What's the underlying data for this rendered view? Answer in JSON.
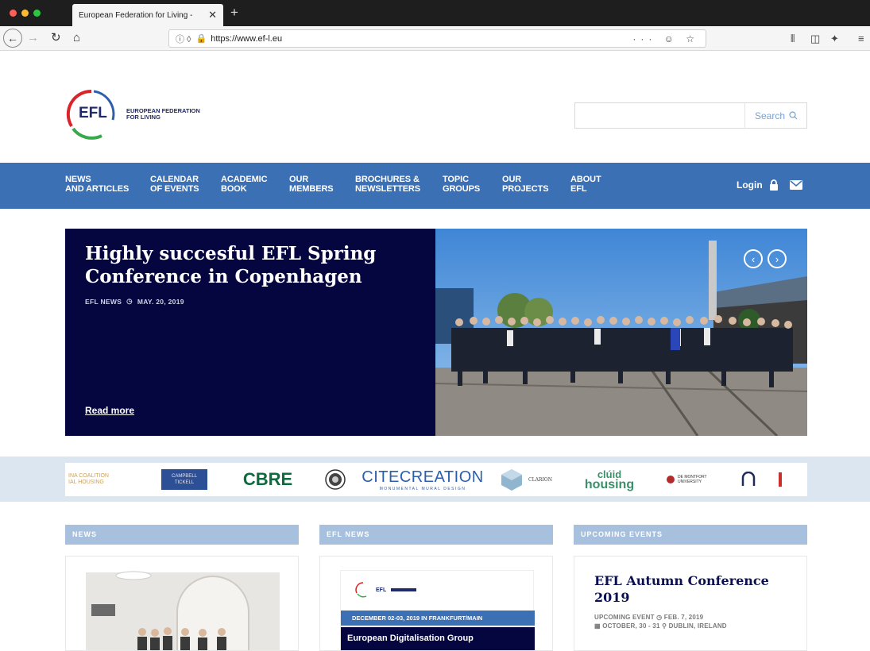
{
  "browser": {
    "tab_title": "European Federation for Living -",
    "tab_close": "✕",
    "new_tab": "+",
    "url": "https://www.ef-l.eu",
    "url_actions": "··· ☺ ☆",
    "overflow": "»"
  },
  "site": {
    "logo_abbr": "EFL",
    "logo_line1": "EUROPEAN FEDERATION",
    "logo_line2": "FOR LIVING"
  },
  "search": {
    "placeholder": "",
    "button_label": "Search"
  },
  "nav": {
    "items": [
      {
        "line1": "NEWS",
        "line2": "AND ARTICLES"
      },
      {
        "line1": "CALENDAR",
        "line2": "OF EVENTS"
      },
      {
        "line1": "ACADEMIC",
        "line2": "BOOK"
      },
      {
        "line1": "OUR",
        "line2": "MEMBERS"
      },
      {
        "line1": "BROCHURES &",
        "line2": "NEWSLETTERS"
      },
      {
        "line1": "TOPIC",
        "line2": "GROUPS"
      },
      {
        "line1": "OUR",
        "line2": "PROJECTS"
      },
      {
        "line1": "ABOUT",
        "line2": "EFL"
      }
    ],
    "login_label": "Login"
  },
  "hero": {
    "title": "Highly succesful EFL Spring Conference in Copenhagen",
    "category": "EFL NEWS",
    "date": "MAY. 20, 2019",
    "read_more": "Read more",
    "prev": "‹",
    "next": "›"
  },
  "members": {
    "logos": [
      {
        "line1": "INA COALITION",
        "line2": "IAL HOUSING"
      },
      {
        "line1": "CAMPBELL",
        "line2": "TICKELL"
      },
      {
        "text": "CBRE"
      },
      {
        "text": "CITECREATION",
        "sub": "MONUMENTAL MURAL DESIGN"
      },
      {
        "text": "CLARION"
      },
      {
        "line1": "clúid",
        "line2": "housing"
      },
      {
        "text": "DE MONTFORT UNIVERSITY"
      }
    ]
  },
  "columns": {
    "news_header": "NEWS",
    "efl_news_header": "EFL NEWS",
    "events_header": "UPCOMING EVENTS"
  },
  "efl_news_card": {
    "logo_abbr": "EFL",
    "banner": "DECEMBER 02-03, 2019 IN FRANKFURT/MAIN",
    "banner_title": "European Digitalisation Group"
  },
  "event": {
    "title": "EFL Autumn Conference 2019",
    "category": "UPCOMING EVENT",
    "posted": "FEB. 7, 2019",
    "dates": "OCTOBER, 30 - 31",
    "location": "DUBLIN, IRELAND"
  },
  "colors": {
    "nav_blue": "#3b70b5",
    "hero_navy": "#05063f",
    "strip_bg": "#dbe6f0",
    "column_header": "#a7c0dd"
  }
}
